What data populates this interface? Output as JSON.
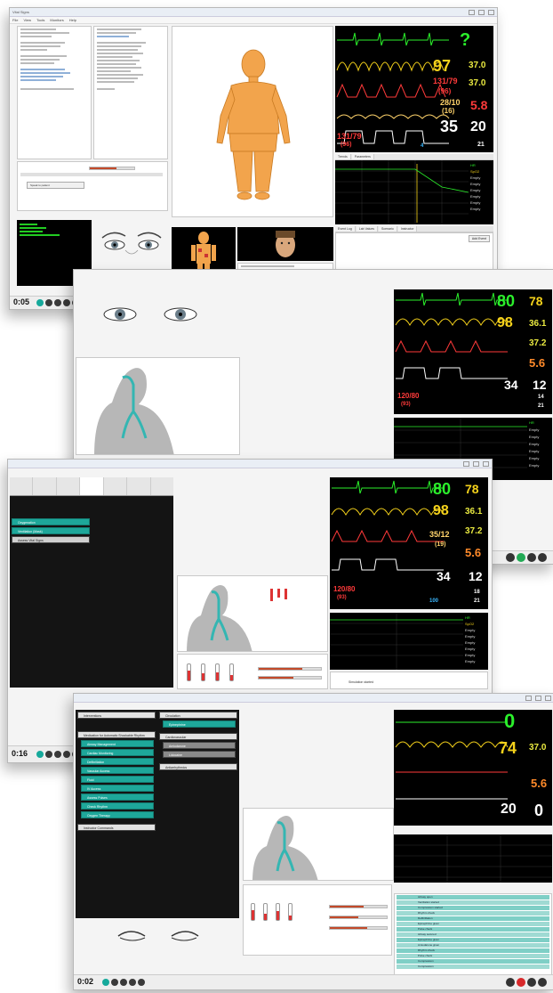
{
  "screen1": {
    "title": "Vital Signs",
    "menu": [
      "File",
      "View",
      "Tools",
      "Monitors",
      "Help"
    ],
    "timer": "0:05",
    "monitor": {
      "hr": "?",
      "spo2": "97",
      "abp": "131/79",
      "abp_mean": "(96)",
      "pap": "28/10",
      "pap_mean": "(16)",
      "etco2": "35",
      "rr": "20",
      "temp1": "37.0",
      "temp2": "37.0",
      "cvp": "5.8",
      "nibp": "131/79",
      "nibp_mean": "(96)",
      "wedge": "4",
      "misc": "21"
    },
    "trend_rows": [
      "HR",
      "SpO2",
      "Empty",
      "Empty",
      "Empty",
      "Empty",
      "Empty",
      "Empty"
    ],
    "event_btn": "Add Event",
    "speech_text": "Speak to patient"
  },
  "screen2": {
    "monitor": {
      "hr": "80",
      "pulse": "78",
      "spo2": "98",
      "temp": "36.1",
      "nibp": "120/80",
      "nibp_mean": "(93)",
      "etco2": "34",
      "rr": "12",
      "cvp": "5.6",
      "t2": "37.2",
      "misc1": "14",
      "misc2": "21"
    },
    "trend_rows": [
      "HR",
      "Empty",
      "Empty",
      "Empty",
      "Empty",
      "Empty",
      "Empty"
    ]
  },
  "screen3": {
    "timer": "0:16",
    "buttons_green": [
      "Oxygenation",
      "Ventilation (Mask)"
    ],
    "button_gray": "Assess Vital Signs",
    "monitor": {
      "hr": "80",
      "pulse": "78",
      "spo2": "98",
      "temp": "36.1",
      "etco2": "35/12",
      "etco2_mean": "(19)",
      "t2": "37.2",
      "cvp": "5.6",
      "rr_ev": "34",
      "rr": "12",
      "nibp": "120/80",
      "nibp_mean": "(93)",
      "w1": "100",
      "w2": "18",
      "w3": "21"
    },
    "trend_rows": [
      "HR",
      "SpO2",
      "Empty",
      "Empty",
      "Empty",
      "Empty",
      "Empty",
      "Empty"
    ],
    "log_text": "Simulation started"
  },
  "screen4": {
    "timer": "0:02",
    "left_sections": [
      "Interventions",
      "Medication for Automatic Shockable Rhythm",
      "Instructor Commands"
    ],
    "left_items": [
      "Airway Management",
      "Cardiac Monitoring",
      "Defibrillation",
      "Vascular Access",
      "Fluid",
      "IV Access",
      "Assess Pulses",
      "Check Rhythm",
      "Oxygen Therapy",
      "Epinephrine",
      "Amiodarone",
      "Lidocaine"
    ],
    "right_sections": [
      "Circulation",
      "Cardiovascular",
      "Antiarrhythmics"
    ],
    "monitor": {
      "hr": "0",
      "spo2": "74",
      "temp": "37.0",
      "etco2": "20",
      "rr": "0",
      "cvp": "5.6"
    },
    "log_rows": [
      "Airway open",
      "Ventilation started",
      "Compression started",
      "Rhythm check",
      "Defibrillation",
      "Epinephrine given",
      "Pulse check",
      "Airway secured",
      "Epinephrine given",
      "Amiodarone given",
      "Rhythm check",
      "Pulse check",
      "Compression",
      "Compression"
    ]
  },
  "colors": {
    "teal": "#1ea79a",
    "hr_green": "#2bf02b",
    "spo2_yellow": "#f5d21b",
    "abp_red": "#ff3a3a",
    "cvp_orange": "#ff8a2a",
    "etco2_white": "#ffffff",
    "temp_yellow": "#e8e840",
    "figure_orange": "#f2a44c"
  }
}
